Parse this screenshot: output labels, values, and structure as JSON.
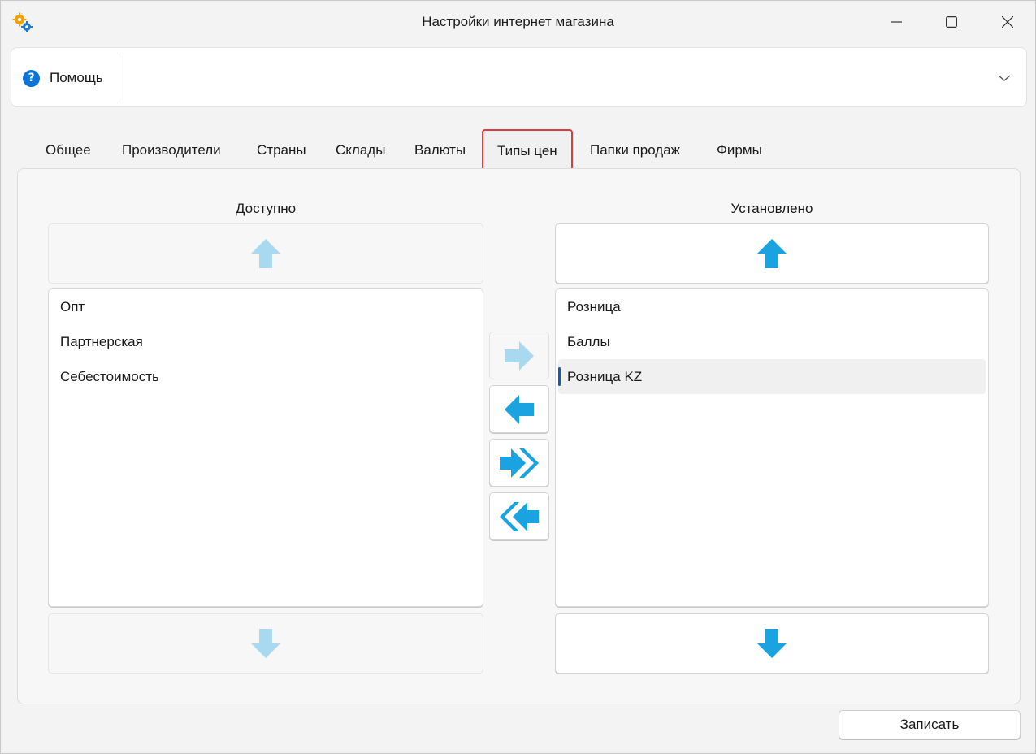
{
  "window": {
    "title": "Настройки интернет магазина"
  },
  "helpbar": {
    "help_label": "Помощь"
  },
  "tabs": [
    {
      "label": "Общее"
    },
    {
      "label": "Производители"
    },
    {
      "label": "Страны"
    },
    {
      "label": "Склады"
    },
    {
      "label": "Валюты"
    },
    {
      "label": "Типы цен",
      "active": true
    },
    {
      "label": "Папки продаж"
    },
    {
      "label": "Фирмы"
    }
  ],
  "available": {
    "title": "Доступно",
    "items": [
      "Опт",
      "Партнерская",
      "Себестоимость"
    ],
    "move_up_enabled": false,
    "move_down_enabled": false
  },
  "installed": {
    "title": "Установлено",
    "items": [
      "Розница",
      "Баллы",
      "Розница KZ"
    ],
    "selected_item": "Розница KZ",
    "move_up_enabled": true,
    "move_down_enabled": true
  },
  "transfer": {
    "add_enabled": false,
    "remove_enabled": true,
    "add_all_enabled": true,
    "remove_all_enabled": true
  },
  "footer": {
    "save_label": "Записать"
  },
  "colors": {
    "accent": "#0b74d6",
    "arrow": "#1aa3e0",
    "arrow_disabled": "#a9d9f0",
    "active_tab_border": "#e03a3a"
  }
}
